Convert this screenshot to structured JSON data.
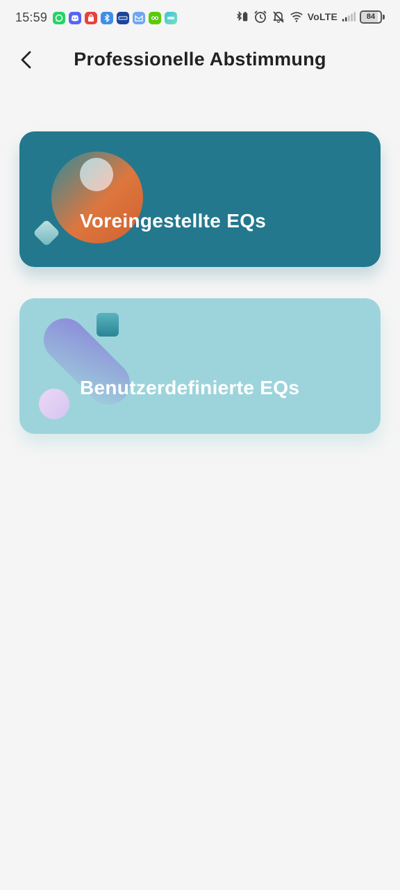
{
  "status_bar": {
    "time": "15:59",
    "network_label": "VoLTE",
    "battery_level": 84,
    "battery_text": "84",
    "notification_icons": [
      "whatsapp-icon",
      "discord-icon",
      "shopping-bag-icon",
      "bluetooth-icon",
      "gmx-icon",
      "gmail-icon",
      "duolingo-icon",
      "app-icon"
    ]
  },
  "header": {
    "title": "Professionelle Abstimmung"
  },
  "cards": [
    {
      "label": "Voreingestellte EQs",
      "color": "#23788d"
    },
    {
      "label": "Benutzerdefinierte EQs",
      "color": "#9dd4dc"
    }
  ]
}
